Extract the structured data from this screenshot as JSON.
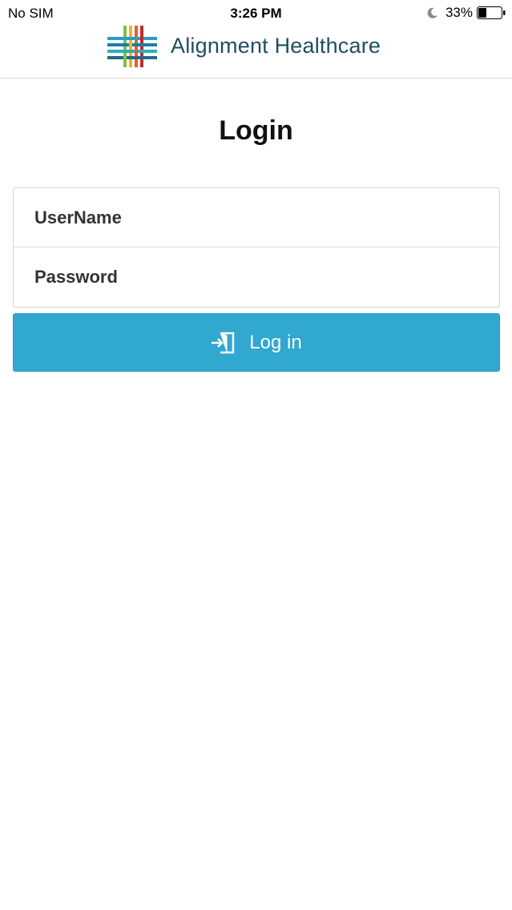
{
  "status_bar": {
    "carrier": "No SIM",
    "time": "3:26 PM",
    "battery_percent": "33%",
    "icons": [
      "moon-icon",
      "battery-icon"
    ]
  },
  "header": {
    "brand_name": "Alignment Healthcare",
    "brand_color": "#1f4e63"
  },
  "page": {
    "title": "Login"
  },
  "form": {
    "username_placeholder": "UserName",
    "password_placeholder": "Password"
  },
  "login_button": {
    "label": "Log in",
    "icon": "login-icon",
    "color": "#31a8d0"
  }
}
